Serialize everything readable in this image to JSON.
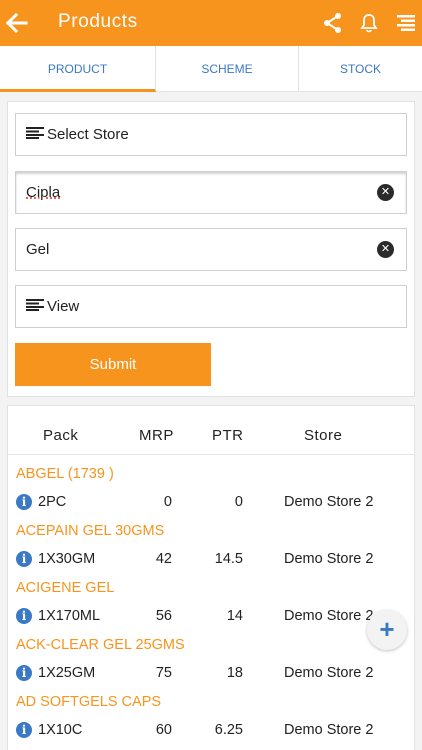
{
  "appbar": {
    "title": "Products"
  },
  "tabs": [
    {
      "label": "PRODUCT"
    },
    {
      "label": "SCHEME"
    },
    {
      "label": "STOCK"
    }
  ],
  "form": {
    "store_label": "Select Store",
    "company_value": "Cipla",
    "product_value": "Gel",
    "view_label": "View",
    "submit_label": "Submit"
  },
  "table": {
    "headers": {
      "pack": "Pack",
      "mrp": "MRP",
      "ptr": "PTR",
      "store": "Store"
    },
    "groups": [
      {
        "name": "ABGEL (1739 )",
        "pack": "2PC",
        "mrp": "0",
        "ptr": "0",
        "store": "Demo Store 2"
      },
      {
        "name": "ACEPAIN GEL 30GMS",
        "pack": "1X30GM",
        "mrp": "42",
        "ptr": "14.5",
        "store": "Demo Store 2"
      },
      {
        "name": "ACIGENE GEL",
        "pack": "1X170ML",
        "mrp": "56",
        "ptr": "14",
        "store": "Demo Store 2"
      },
      {
        "name": "ACK-CLEAR GEL 25GMS",
        "pack": "1X25GM",
        "mrp": "75",
        "ptr": "18",
        "store": "Demo Store 2"
      },
      {
        "name": "AD SOFTGELS CAPS",
        "pack": "1X10C",
        "mrp": "60",
        "ptr": "6.25",
        "store": "Demo Store 2"
      }
    ]
  },
  "colors": {
    "accent": "#f7941d",
    "link": "#3a79c4"
  },
  "icons": [
    "back-arrow-icon",
    "share-icon",
    "bell-icon",
    "menu-icon",
    "list-icon",
    "clear-icon",
    "info-icon",
    "plus-icon"
  ]
}
